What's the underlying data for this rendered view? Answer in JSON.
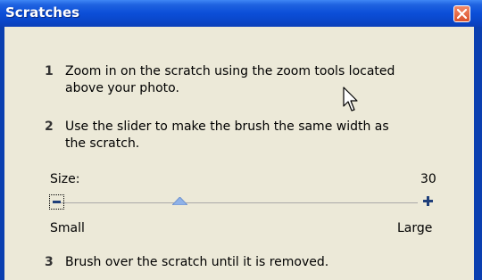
{
  "window": {
    "title": "Scratches"
  },
  "steps": [
    {
      "number": "1",
      "line1": "Zoom in on the scratch using the zoom tools located",
      "line2": "above your photo."
    },
    {
      "number": "2",
      "line1": "Use the slider to make the brush the same width as",
      "line2": "the scratch."
    },
    {
      "number": "3",
      "line1": "Brush over the scratch until it is removed."
    }
  ],
  "size_slider": {
    "label": "Size:",
    "value_text": "30",
    "min_label": "Small",
    "max_label": "Large"
  },
  "icons": {
    "close": "close-icon",
    "minus": "minus-icon",
    "plus": "plus-icon",
    "cursor": "mouse-pointer-icon"
  },
  "colors": {
    "titlebar": "#0b4ed8",
    "frame": "#0a3fb0",
    "client_bg": "#ece9d8",
    "close_button": "#d9512c",
    "thumb": "#8fb2e8"
  }
}
